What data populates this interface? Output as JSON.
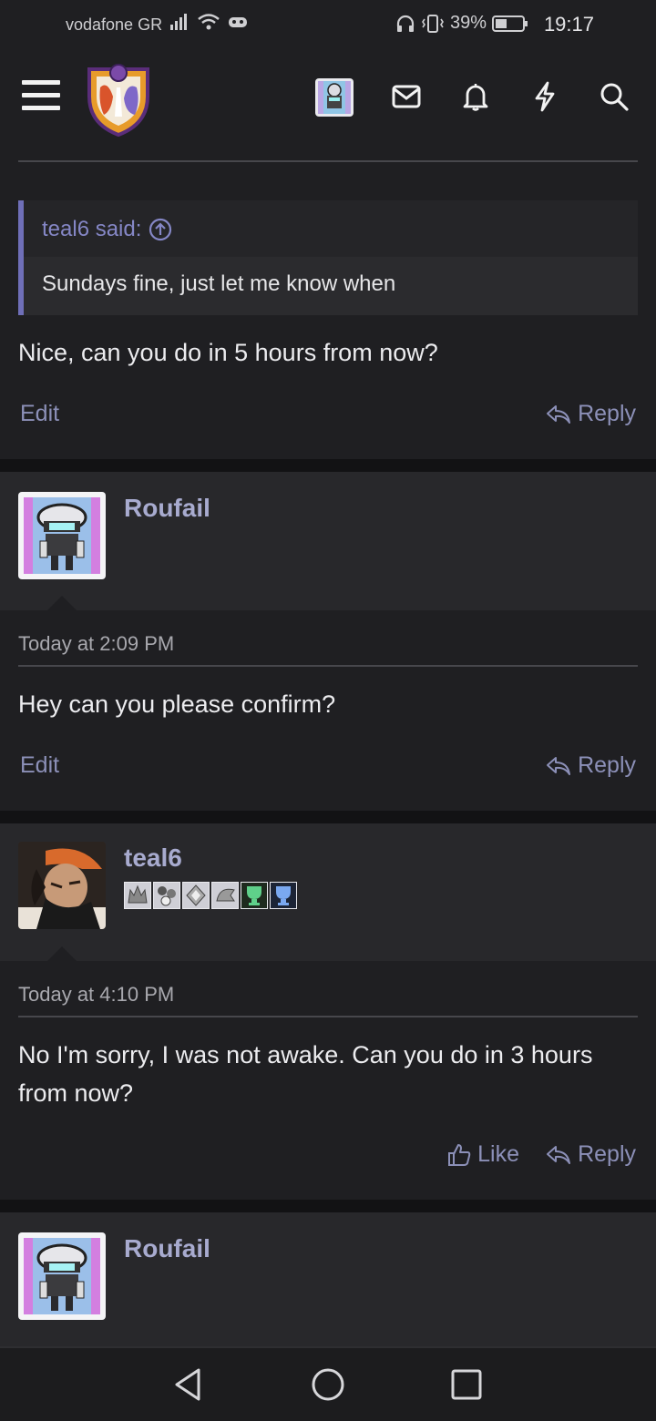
{
  "status_bar": {
    "carrier": "vodafone GR",
    "battery": "39%",
    "time": "19:17"
  },
  "header": {
    "icons": [
      "menu-icon",
      "site-logo",
      "user-avatar",
      "inbox-icon",
      "bell-icon",
      "bolt-icon",
      "search-icon"
    ]
  },
  "posts": [
    {
      "quote_author": "teal6 said:",
      "quote_text": "Sundays fine, just let me know when",
      "text": "Nice, can you do in 5 hours from now?",
      "actions": {
        "edit": "Edit",
        "reply": "Reply"
      }
    },
    {
      "username": "Roufail",
      "timestamp": "Today at 2:09 PM",
      "text": "Hey can you please confirm?",
      "actions": {
        "edit": "Edit",
        "reply": "Reply"
      }
    },
    {
      "username": "teal6",
      "timestamp": "Today at 4:10 PM",
      "text": "No I'm sorry, I was not awake. Can you do in 3 hours from now?",
      "actions": {
        "like": "Like",
        "reply": "Reply"
      }
    },
    {
      "username": "Roufail"
    }
  ],
  "colors": {
    "accent": "#8c90b8",
    "username": "#a8abcf",
    "quote_bar": "#6f6fb8",
    "background": "#1f1f22"
  }
}
